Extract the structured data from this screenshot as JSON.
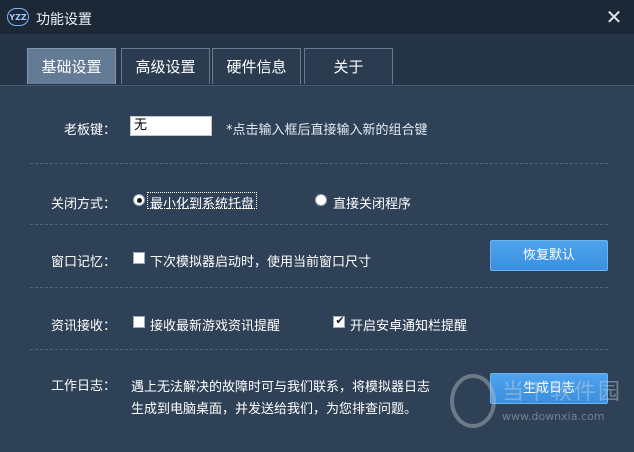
{
  "window": {
    "title": "功能设置",
    "logo_text": "YZZ",
    "close_glyph": "✕"
  },
  "tabs": [
    {
      "label": "基础设置",
      "active": true
    },
    {
      "label": "高级设置",
      "active": false
    },
    {
      "label": "硬件信息",
      "active": false
    },
    {
      "label": "关于",
      "active": false
    }
  ],
  "boss_key": {
    "label": "老板键：",
    "value": "无",
    "hint": "*点击输入框后直接输入新的组合键"
  },
  "close_mode": {
    "label": "关闭方式：",
    "option_minimize": "最小化到系统托盘",
    "option_close": "直接关闭程序",
    "selected": "最小化到系统托盘"
  },
  "window_memory": {
    "label": "窗口记忆：",
    "checkbox_label": "下次模拟器启动时，使用当前窗口尺寸",
    "checked": false,
    "button": "恢复默认"
  },
  "news": {
    "label": "资讯接收：",
    "option_games": "接收最新游戏资讯提醒",
    "option_games_checked": false,
    "option_android": "开启安卓通知栏提醒",
    "option_android_checked": true
  },
  "work_log": {
    "label": "工作日志：",
    "description_line1": "遇上无法解决的故障时可与我们联系，将模拟器日志",
    "description_line2": "生成到电脑桌面，并发送给我们，为您排查问题。",
    "button": "生成日志"
  },
  "watermark": {
    "text": "当下软件园",
    "url": "www.downxia.com"
  },
  "colors": {
    "background": "#2f4156",
    "titlebar": "#1c2836",
    "tab_active": "#647b96",
    "button_blue": "#3d92e2"
  }
}
